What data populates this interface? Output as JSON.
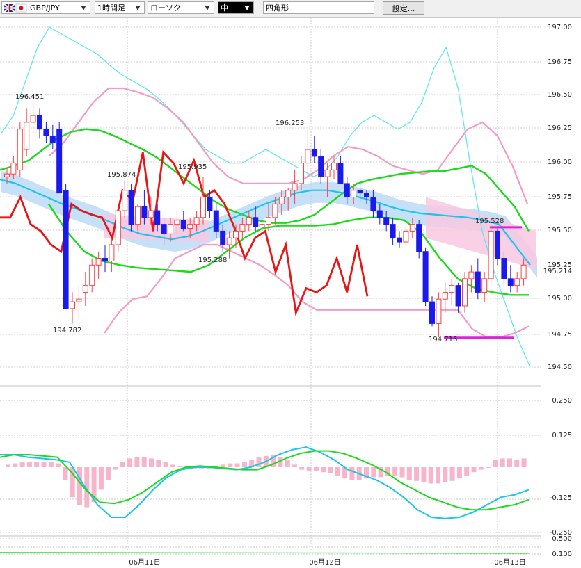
{
  "toolbar": {
    "symbol": "GBP/JPY",
    "timeframe": "1時間足",
    "chart_style": "ローソク",
    "size": "中",
    "shape": "四角形",
    "settings_label": "設定..."
  },
  "colors": {
    "bull_candle": "#ff4040",
    "bear_candle": "#1a1aee",
    "bb_outer": "#5ee8f0",
    "bb_inner": "#f59ac4",
    "ma_green": "#1adb1a",
    "ma_blue": "#19c5ec",
    "red_line": "#e81515",
    "cloud_blue": "#b8d8f5",
    "cloud_pink": "#f8c8e0",
    "rect_marker": "#e020e0",
    "macd_hist": "#f8b4c8"
  },
  "chart_data": [
    {
      "type": "candlestick",
      "title": "GBP/JPY",
      "ylim": [
        194.3,
        197.05
      ],
      "ytick_labels": [
        "197.00",
        "196.75",
        "196.50",
        "196.25",
        "196.00",
        "195.75",
        "195.50",
        "195.25",
        "195.214",
        "195.00",
        "194.75",
        "194.50"
      ],
      "x_labels": [
        "06月11日",
        "06月12日",
        "06月13日"
      ],
      "current_price": 195.214,
      "annotations": [
        {
          "text": "196.451",
          "value": 196.451
        },
        {
          "text": "194.782",
          "value": 194.782
        },
        {
          "text": "195.874",
          "value": 195.874
        },
        {
          "text": "195.935",
          "value": 195.935
        },
        {
          "text": "195.288",
          "value": 195.288
        },
        {
          "text": "196.253",
          "value": 196.253
        },
        {
          "text": "195.528",
          "value": 195.528
        },
        {
          "text": "194.716",
          "value": 194.716
        }
      ],
      "candles": [
        [
          195.9,
          195.97,
          195.85,
          195.92
        ],
        [
          195.92,
          196.05,
          195.88,
          196.0
        ],
        [
          195.95,
          196.3,
          195.9,
          196.25
        ],
        [
          196.1,
          196.4,
          196.05,
          196.3
        ],
        [
          196.3,
          196.45,
          196.22,
          196.35
        ],
        [
          196.35,
          196.4,
          196.18,
          196.25
        ],
        [
          196.25,
          196.3,
          196.15,
          196.2
        ],
        [
          196.2,
          196.28,
          196.1,
          196.15
        ],
        [
          196.25,
          196.3,
          195.8,
          195.78
        ],
        [
          195.8,
          195.85,
          194.95,
          194.93
        ],
        [
          194.93,
          195.05,
          194.82,
          194.98
        ],
        [
          194.98,
          195.1,
          194.85,
          195.0
        ],
        [
          195.05,
          195.2,
          194.95,
          195.1
        ],
        [
          195.1,
          195.3,
          195.05,
          195.25
        ],
        [
          195.25,
          195.35,
          195.15,
          195.3
        ],
        [
          195.3,
          195.4,
          195.2,
          195.28
        ],
        [
          195.28,
          195.45,
          195.2,
          195.4
        ],
        [
          195.4,
          195.7,
          195.35,
          195.65
        ],
        [
          195.65,
          195.87,
          195.6,
          195.8
        ],
        [
          195.8,
          195.85,
          195.5,
          195.55
        ],
        [
          195.55,
          195.7,
          195.5,
          195.68
        ],
        [
          195.68,
          195.8,
          195.55,
          195.6
        ],
        [
          195.6,
          195.75,
          195.55,
          195.65
        ],
        [
          195.65,
          195.7,
          195.5,
          195.55
        ],
        [
          195.55,
          195.6,
          195.4,
          195.48
        ],
        [
          195.48,
          195.6,
          195.42,
          195.55
        ],
        [
          195.55,
          195.65,
          195.48,
          195.58
        ],
        [
          195.58,
          195.65,
          195.5,
          195.52
        ],
        [
          195.52,
          195.6,
          195.45,
          195.55
        ],
        [
          195.55,
          195.65,
          195.5,
          195.6
        ],
        [
          195.6,
          195.9,
          195.55,
          195.75
        ],
        [
          195.75,
          195.8,
          195.6,
          195.65
        ],
        [
          195.65,
          195.7,
          195.45,
          195.5
        ],
        [
          195.5,
          195.55,
          195.35,
          195.4
        ],
        [
          195.4,
          195.5,
          195.3,
          195.45
        ],
        [
          195.45,
          195.55,
          195.38,
          195.5
        ],
        [
          195.5,
          195.6,
          195.45,
          195.55
        ],
        [
          195.55,
          195.65,
          195.5,
          195.6
        ],
        [
          195.6,
          195.68,
          195.5,
          195.53
        ],
        [
          195.53,
          195.6,
          195.45,
          195.55
        ],
        [
          195.55,
          195.7,
          195.5,
          195.6
        ],
        [
          195.6,
          195.75,
          195.55,
          195.7
        ],
        [
          195.7,
          195.8,
          195.62,
          195.75
        ],
        [
          195.75,
          195.82,
          195.65,
          195.8
        ],
        [
          195.8,
          195.95,
          195.7,
          195.85
        ],
        [
          195.85,
          196.05,
          195.8,
          196.0
        ],
        [
          196.0,
          196.25,
          195.9,
          196.1
        ],
        [
          196.1,
          196.2,
          196.0,
          196.05
        ],
        [
          196.05,
          196.1,
          195.85,
          195.9
        ],
        [
          195.9,
          196.0,
          195.75,
          195.95
        ],
        [
          195.95,
          196.05,
          195.88,
          196.0
        ],
        [
          196.0,
          196.05,
          195.85,
          195.85
        ],
        [
          195.85,
          195.9,
          195.7,
          195.75
        ],
        [
          195.75,
          195.85,
          195.7,
          195.8
        ],
        [
          195.8,
          195.85,
          195.72,
          195.78
        ],
        [
          195.78,
          195.8,
          195.7,
          195.75
        ],
        [
          195.75,
          195.8,
          195.6,
          195.65
        ],
        [
          195.65,
          195.7,
          195.55,
          195.6
        ],
        [
          195.6,
          195.65,
          195.5,
          195.55
        ],
        [
          195.55,
          195.6,
          195.4,
          195.45
        ],
        [
          195.45,
          195.5,
          195.38,
          195.42
        ],
        [
          195.42,
          195.55,
          195.4,
          195.5
        ],
        [
          195.5,
          195.6,
          195.45,
          195.55
        ],
        [
          195.55,
          195.58,
          195.3,
          195.35
        ],
        [
          195.35,
          195.38,
          194.95,
          194.98
        ],
        [
          194.98,
          195.02,
          194.8,
          194.82
        ],
        [
          194.82,
          195.05,
          194.72,
          195.0
        ],
        [
          195.0,
          195.12,
          194.9,
          195.05
        ],
        [
          195.05,
          195.15,
          194.95,
          195.1
        ],
        [
          195.1,
          195.12,
          194.9,
          194.95
        ],
        [
          194.95,
          195.2,
          194.9,
          195.15
        ],
        [
          195.15,
          195.25,
          195.05,
          195.2
        ],
        [
          195.2,
          195.3,
          195.0,
          195.05
        ],
        [
          195.05,
          195.2,
          194.98,
          195.15
        ],
        [
          195.15,
          195.53,
          195.1,
          195.5
        ],
        [
          195.5,
          195.52,
          195.25,
          195.3
        ],
        [
          195.3,
          195.35,
          195.1,
          195.15
        ],
        [
          195.15,
          195.25,
          195.05,
          195.1
        ],
        [
          195.1,
          195.2,
          195.05,
          195.15
        ],
        [
          195.15,
          195.3,
          195.1,
          195.25
        ]
      ],
      "series": [
        {
          "name": "",
          "color_key": "bb_outer",
          "values": [
            196.22,
            196.35,
            196.6,
            196.85,
            197.0,
            196.95,
            196.9,
            196.85,
            196.8,
            196.72,
            196.65,
            196.6,
            196.55,
            196.48,
            196.4,
            196.3,
            196.2,
            196.1,
            196.05,
            196.0,
            196.0,
            196.05,
            196.1,
            196.05,
            196.0,
            195.95,
            195.9,
            195.95,
            196.05,
            196.2,
            196.3,
            196.35,
            196.3,
            196.25,
            196.3,
            196.45,
            196.7,
            196.85,
            196.55,
            196.0,
            195.5,
            195.2,
            194.95,
            194.7,
            194.5
          ]
        },
        {
          "name": "",
          "color_key": "bb_inner",
          "values": [
            196.05,
            196.15,
            196.3,
            196.45,
            196.55,
            196.55,
            196.52,
            196.48,
            196.4,
            196.3,
            196.15,
            196.0,
            195.9,
            195.85,
            195.85,
            195.85,
            195.85,
            195.88,
            195.95,
            196.05,
            196.12,
            196.1,
            196.05,
            195.98,
            195.95,
            195.92,
            195.95,
            196.1,
            196.25,
            196.3,
            196.2,
            195.98,
            195.7
          ]
        },
        {
          "name": "",
          "color_key": "bb_inner",
          "values": [
            194.75,
            194.9,
            195.0,
            195.02,
            195.15,
            195.3,
            195.35,
            195.4,
            195.4,
            195.35,
            195.3,
            195.25,
            195.18,
            195.1,
            194.98,
            194.92,
            194.92,
            194.92,
            194.92,
            194.92,
            194.92,
            194.92,
            194.92,
            194.92,
            194.92,
            194.92,
            194.78,
            194.72,
            194.72,
            194.75,
            194.8
          ]
        },
        {
          "name": "",
          "color_key": "ma_green",
          "values": [
            195.95,
            195.98,
            196.02,
            196.1,
            196.18,
            196.23,
            196.25,
            196.24,
            196.2,
            196.15,
            196.1,
            196.04,
            195.96,
            195.88,
            195.8,
            195.72,
            195.66,
            195.62,
            195.58,
            195.56,
            195.56,
            195.58,
            195.62,
            195.7,
            195.78,
            195.85,
            195.88,
            195.9,
            195.92,
            195.93,
            195.94,
            195.94,
            195.96,
            195.98,
            195.92,
            195.8,
            195.68,
            195.5
          ]
        },
        {
          "name": "",
          "color_key": "ma_green",
          "values": [
            195.7,
            195.5,
            195.35,
            195.28,
            195.25,
            195.23,
            195.22,
            195.21,
            195.2,
            195.25,
            195.35,
            195.45,
            195.52,
            195.54,
            195.54,
            195.54,
            195.55,
            195.58,
            195.6,
            195.6,
            195.58,
            195.48,
            195.3,
            195.15,
            195.08,
            195.05,
            195.03,
            195.03
          ]
        },
        {
          "name": "",
          "color_key": "ma_blue",
          "values": [
            195.88,
            195.85,
            195.8,
            195.75,
            195.7,
            195.66,
            195.62,
            195.57,
            195.52,
            195.48,
            195.46,
            195.44,
            195.46,
            195.5,
            195.55,
            195.6,
            195.65,
            195.7,
            195.74,
            195.78,
            195.8,
            195.8,
            195.78,
            195.75,
            195.72,
            195.68,
            195.65,
            195.63,
            195.62,
            195.61,
            195.6,
            195.58,
            195.55,
            195.4,
            195.25
          ]
        },
        {
          "name": "",
          "color_key": "red_line",
          "values": [
            195.6,
            195.6,
            195.75,
            195.55,
            195.5,
            195.4,
            195.35,
            195.7,
            195.65,
            195.62,
            195.6,
            195.45,
            195.8,
            195.72,
            196.08,
            195.5,
            196.08,
            196.0,
            195.85,
            196.02,
            195.75,
            195.8,
            195.7,
            195.52,
            195.3,
            195.45,
            195.5,
            195.2,
            195.4,
            194.9,
            195.08,
            195.05,
            195.1,
            195.3,
            195.05,
            195.4,
            195.02
          ]
        }
      ],
      "rect_marker": {
        "top": 195.528,
        "bottom": 194.716
      }
    },
    {
      "type": "bar",
      "title": "MACD",
      "ylim": [
        -0.265,
        0.145
      ],
      "ytick_labels": [
        "0.250",
        "0.125",
        "-0.125",
        "-0.250"
      ],
      "values": [
        0.01,
        0.015,
        0.02,
        0.02,
        0.02,
        0.02,
        0.02,
        0.015,
        -0.05,
        -0.12,
        -0.15,
        -0.16,
        -0.14,
        -0.09,
        -0.05,
        -0.01,
        0.02,
        0.035,
        0.04,
        0.04,
        0.035,
        0.03,
        0.02,
        0.01,
        0.005,
        -0.005,
        -0.005,
        -0.005,
        -0.005,
        0.005,
        0.01,
        0.015,
        0.015,
        0.02,
        0.03,
        0.04,
        0.045,
        0.05,
        0.04,
        0.03,
        0.01,
        -0.01,
        -0.015,
        -0.015,
        -0.02,
        -0.025,
        -0.035,
        -0.045,
        -0.05,
        -0.05,
        -0.045,
        -0.04,
        -0.04,
        -0.035,
        -0.035,
        -0.04,
        -0.05,
        -0.055,
        -0.06,
        -0.065,
        -0.065,
        -0.06,
        -0.055,
        -0.045,
        -0.035,
        -0.02,
        -0.01,
        0.0,
        0.03,
        0.035,
        0.035,
        0.03,
        0.035
      ],
      "series": [
        {
          "name": "",
          "color_key": "ma_blue",
          "values": [
            0.05,
            0.05,
            0.04,
            0.035,
            0.03,
            0.02,
            -0.07,
            -0.15,
            -0.2,
            -0.2,
            -0.15,
            -0.09,
            -0.04,
            -0.01,
            0.0,
            0.0,
            -0.005,
            -0.01,
            0.0,
            0.02,
            0.05,
            0.07,
            0.08,
            0.06,
            0.03,
            -0.01,
            -0.03,
            -0.05,
            -0.08,
            -0.12,
            -0.17,
            -0.2,
            -0.205,
            -0.2,
            -0.18,
            -0.15,
            -0.12,
            -0.11,
            -0.09
          ]
        },
        {
          "name": "",
          "color_key": "ma_green",
          "values": [
            0.04,
            0.05,
            0.05,
            0.045,
            0.04,
            -0.02,
            -0.09,
            -0.14,
            -0.145,
            -0.13,
            -0.1,
            -0.06,
            -0.02,
            0.0,
            0.005,
            0.0,
            -0.005,
            -0.01,
            -0.01,
            0.01,
            0.035,
            0.055,
            0.065,
            0.065,
            0.055,
            0.035,
            0.01,
            -0.02,
            -0.06,
            -0.09,
            -0.12,
            -0.14,
            -0.16,
            -0.17,
            -0.17,
            -0.16,
            -0.15,
            -0.13
          ]
        }
      ]
    },
    {
      "type": "line",
      "title": "",
      "ylim": [
        0.1,
        0.5
      ],
      "ytick_labels": [
        "0.500",
        "0.100"
      ]
    }
  ]
}
